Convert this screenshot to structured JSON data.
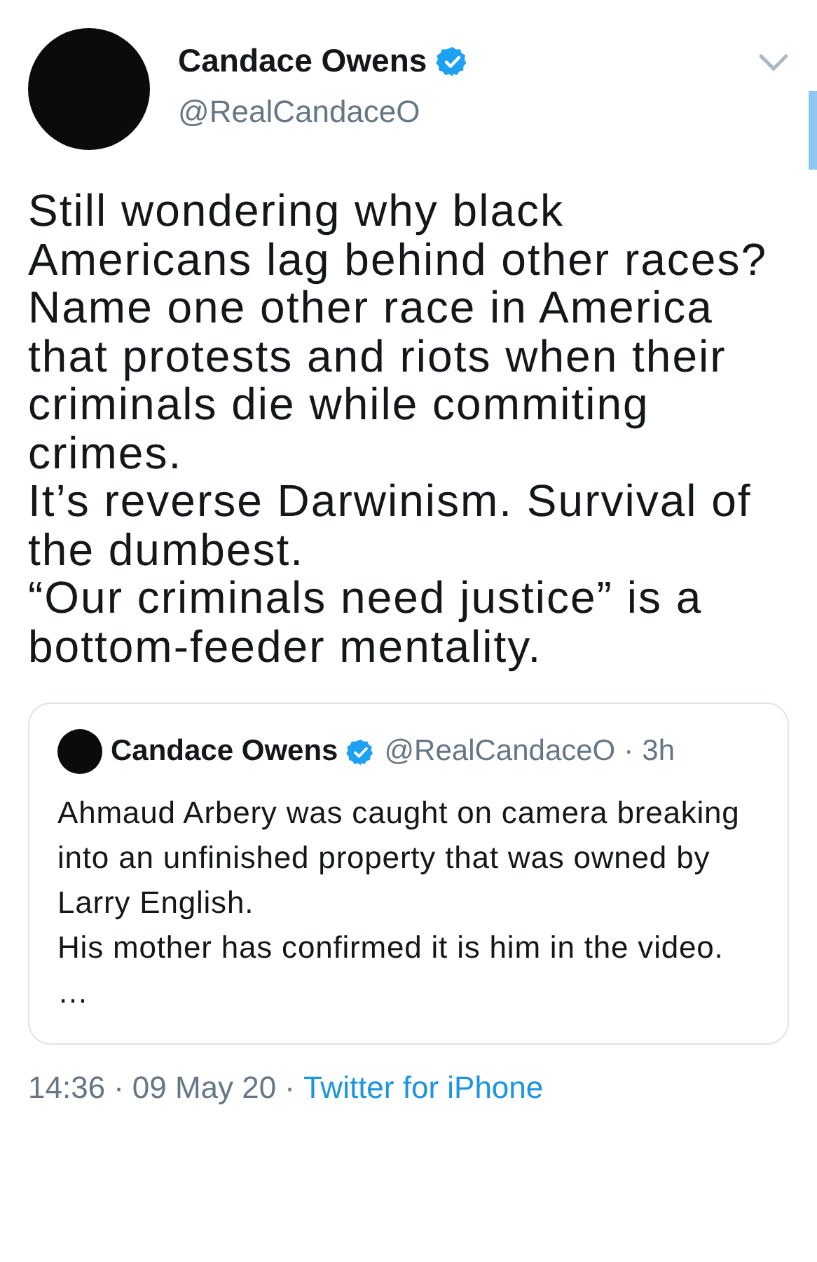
{
  "tweet": {
    "author": {
      "name": "Candace Owens",
      "verified": true,
      "handle": "@RealCandaceO"
    },
    "text": "Still wondering why black Americans lag behind other races? Name one other race in America that protests and riots when their criminals die while commiting crimes.\nIt’s reverse Darwinism. Survival of the dumbest.\n“Our criminals need justice” is a bottom-feeder mentality.",
    "quoted_tweet": {
      "author": {
        "name": "Candace Owens",
        "verified": true,
        "handle": "@RealCandaceO"
      },
      "separator": "·",
      "age": "3h",
      "text": "Ahmaud Arbery was caught on camera breaking into an unfinished property that was owned by Larry English.\nHis mother has confirmed it is him in the video. …"
    },
    "footer": {
      "time": "14:36",
      "separator_1": "·",
      "date": "09 May 20",
      "separator_2": "·",
      "source": "Twitter for iPhone"
    }
  }
}
